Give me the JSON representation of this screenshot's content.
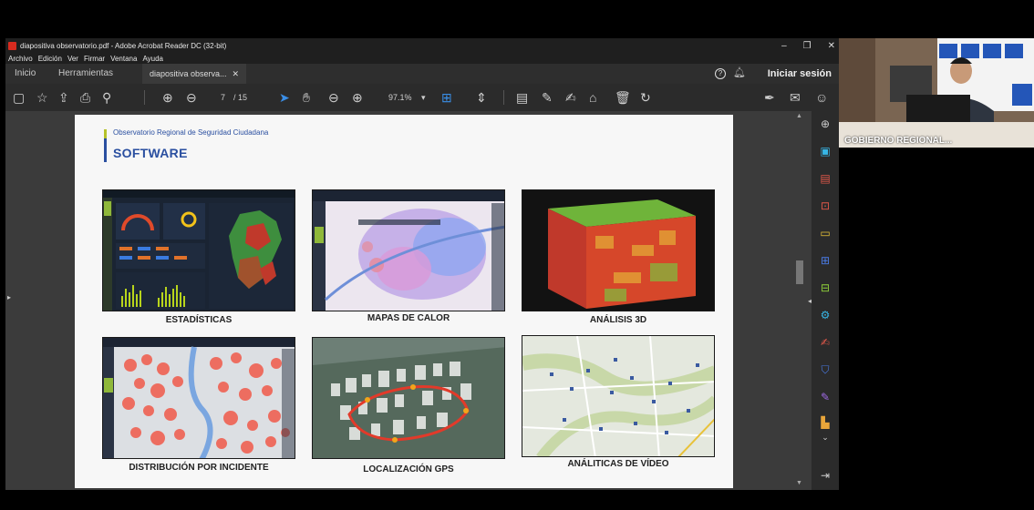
{
  "window": {
    "title": "diapositiva observatorio.pdf - Adobe Acrobat Reader DC (32-bit)",
    "controls": [
      "–",
      "❐",
      "✕"
    ]
  },
  "menu": [
    "Archivo",
    "Edición",
    "Ver",
    "Firmar",
    "Ventana",
    "Ayuda"
  ],
  "tabs": {
    "home": "Inicio",
    "tools": "Herramientas",
    "document": "diapositiva observa...",
    "close": "✕",
    "help": "?",
    "signin": "Iniciar sesión"
  },
  "toolbar": {
    "page_current": "7",
    "page_total": "/ 15",
    "zoom": "97.1%"
  },
  "slide": {
    "subtitle": "Observatorio Regional de Seguridad Ciudadana",
    "title": "SOFTWARE",
    "panels": [
      {
        "caption": "ESTADÍSTICAS"
      },
      {
        "caption": "MAPAS DE CALOR"
      },
      {
        "caption": "ANÁLISIS 3D"
      },
      {
        "caption": "DISTRIBUCIÓN POR INCIDENTE"
      },
      {
        "caption": "LOCALIZACIÓN GPS"
      },
      {
        "caption": "ANÁLITICAS DE VÍDEO"
      }
    ]
  },
  "webcam": {
    "label": "GOBIERNO REGIONAL..."
  },
  "colors": {
    "accent_blue": "#2a4fa0",
    "accent_green": "#b5c22a",
    "tool_blue": "#3a8ee6"
  }
}
